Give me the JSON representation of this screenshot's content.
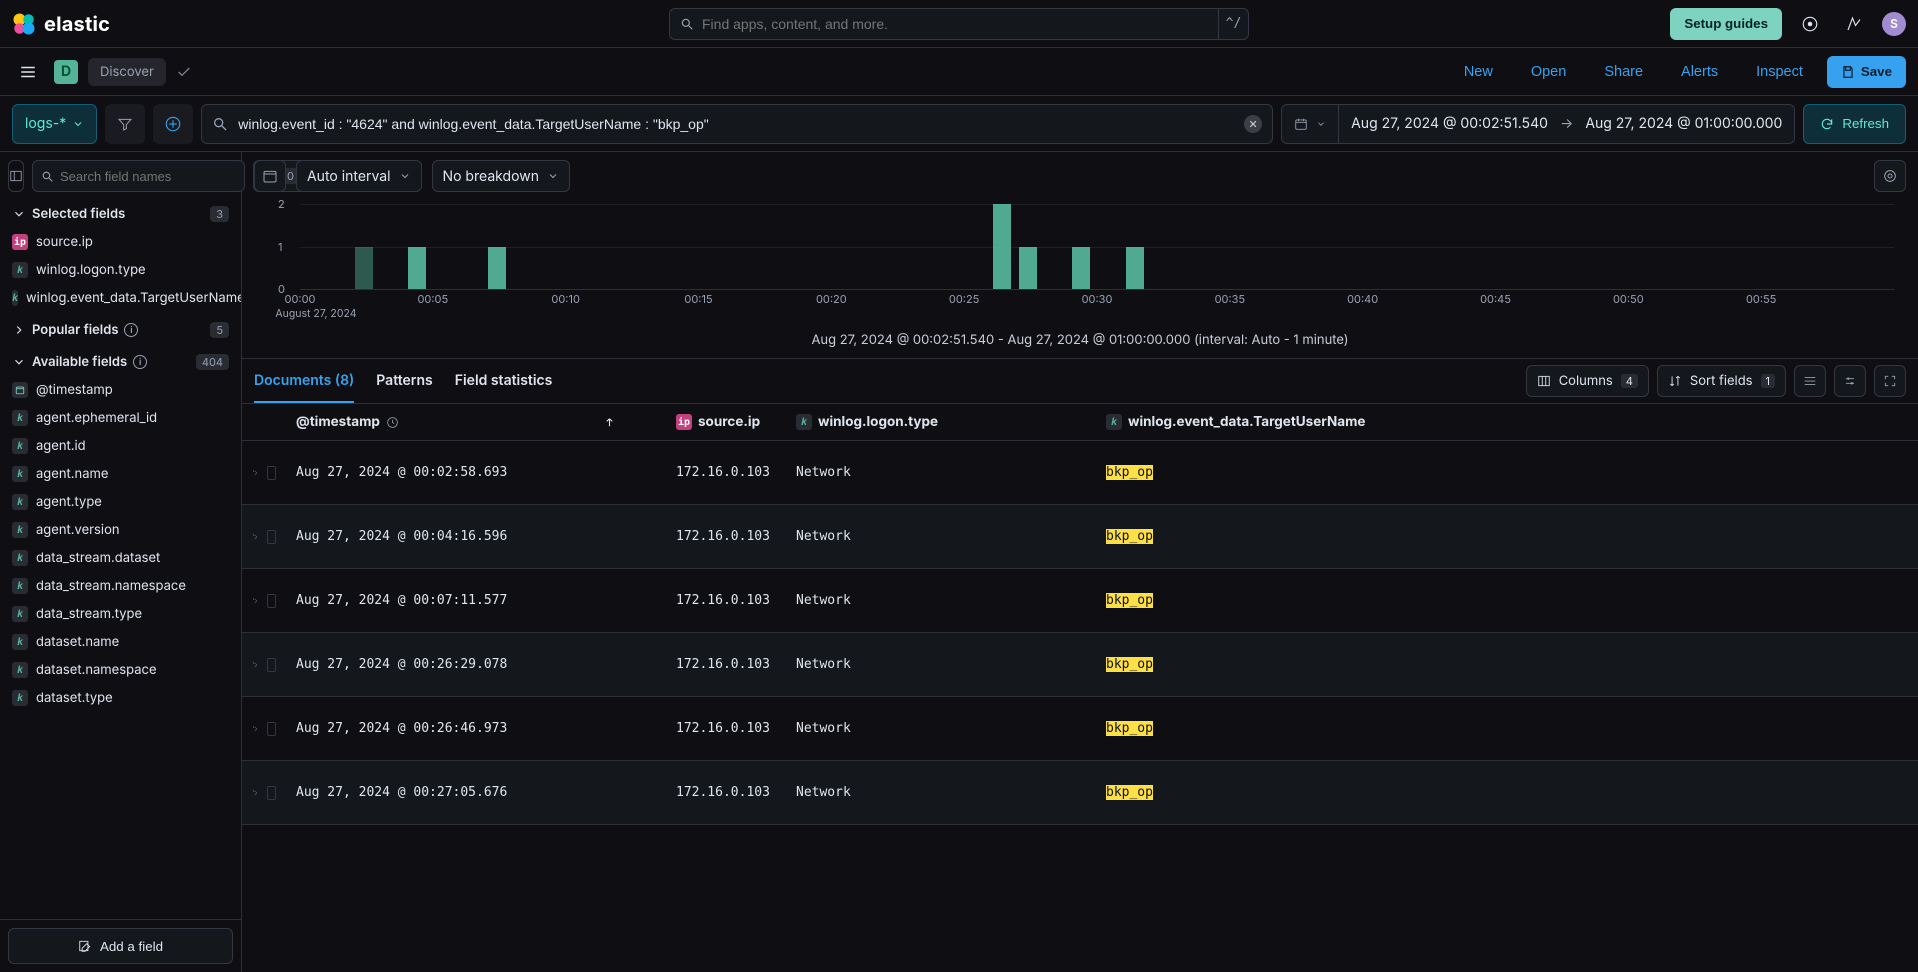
{
  "brand": {
    "text": "elastic",
    "avatar": "S"
  },
  "top": {
    "search_placeholder": "Find apps, content, and more.",
    "shortcut": "^/",
    "setup_guides": "Setup guides"
  },
  "app": {
    "badge": "D",
    "name": "Discover",
    "menu": {
      "new": "New",
      "open": "Open",
      "share": "Share",
      "alerts": "Alerts",
      "inspect": "Inspect",
      "save": "Save"
    }
  },
  "query": {
    "data_view": "logs-*",
    "kql": "winlog.event_id : \"4624\" and winlog.event_data.TargetUserName : \"bkp_op\"",
    "time_start": "Aug 27, 2024 @ 00:02:51.540",
    "time_end": "Aug 27, 2024 @ 01:00:00.000",
    "refresh": "Refresh"
  },
  "sidebar": {
    "search_placeholder": "Search field names",
    "filter_count": "0",
    "sections": {
      "selected": {
        "label": "Selected fields",
        "count": "3"
      },
      "popular": {
        "label": "Popular fields",
        "count": "5"
      },
      "available": {
        "label": "Available fields",
        "count": "404"
      }
    },
    "selected_fields": [
      {
        "icon": "ip",
        "name": "source.ip"
      },
      {
        "icon": "k",
        "name": "winlog.logon.type"
      },
      {
        "icon": "k",
        "name": "winlog.event_data.TargetUserName"
      }
    ],
    "available_fields": [
      {
        "icon": "dt",
        "name": "@timestamp"
      },
      {
        "icon": "k",
        "name": "agent.ephemeral_id"
      },
      {
        "icon": "k",
        "name": "agent.id"
      },
      {
        "icon": "k",
        "name": "agent.name"
      },
      {
        "icon": "k",
        "name": "agent.type"
      },
      {
        "icon": "k",
        "name": "agent.version"
      },
      {
        "icon": "k",
        "name": "data_stream.dataset"
      },
      {
        "icon": "k",
        "name": "data_stream.namespace"
      },
      {
        "icon": "k",
        "name": "data_stream.type"
      },
      {
        "icon": "k",
        "name": "dataset.name"
      },
      {
        "icon": "k",
        "name": "dataset.namespace"
      },
      {
        "icon": "k",
        "name": "dataset.type"
      }
    ],
    "add_field": "Add a field"
  },
  "histo": {
    "interval": "Auto interval",
    "breakdown": "No breakdown",
    "caption": "Aug 27, 2024 @ 00:02:51.540 - Aug 27, 2024 @ 01:00:00.000 (interval: Auto - 1 minute)"
  },
  "chart_data": {
    "type": "bar",
    "title": "",
    "xlabel": "August 27, 2024",
    "ylabel": "",
    "ylim": [
      0,
      2
    ],
    "categories_ticks": [
      "00:00",
      "00:05",
      "00:10",
      "00:15",
      "00:20",
      "00:25",
      "00:30",
      "00:35",
      "00:40",
      "00:45",
      "00:50",
      "00:55"
    ],
    "bars": [
      {
        "minute": 2,
        "value": 1
      },
      {
        "minute": 4,
        "value": 1
      },
      {
        "minute": 7,
        "value": 1
      },
      {
        "minute": 26,
        "value": 2
      },
      {
        "minute": 27,
        "value": 1
      },
      {
        "minute": 29,
        "value": 1
      },
      {
        "minute": 31,
        "value": 1
      }
    ]
  },
  "tabs": {
    "documents": "Documents (8)",
    "patterns": "Patterns",
    "field_stats": "Field statistics"
  },
  "grid_toolbar": {
    "columns": "Columns",
    "columns_n": "4",
    "sort": "Sort fields",
    "sort_n": "1"
  },
  "columns": {
    "ts": "@timestamp",
    "ip": "source.ip",
    "lt": "winlog.logon.type",
    "un": "winlog.event_data.TargetUserName"
  },
  "rows": [
    {
      "ts": "Aug 27, 2024 @ 00:02:58.693",
      "ip": "172.16.0.103",
      "lt": "Network",
      "un": "bkp_op"
    },
    {
      "ts": "Aug 27, 2024 @ 00:04:16.596",
      "ip": "172.16.0.103",
      "lt": "Network",
      "un": "bkp_op"
    },
    {
      "ts": "Aug 27, 2024 @ 00:07:11.577",
      "ip": "172.16.0.103",
      "lt": "Network",
      "un": "bkp_op"
    },
    {
      "ts": "Aug 27, 2024 @ 00:26:29.078",
      "ip": "172.16.0.103",
      "lt": "Network",
      "un": "bkp_op"
    },
    {
      "ts": "Aug 27, 2024 @ 00:26:46.973",
      "ip": "172.16.0.103",
      "lt": "Network",
      "un": "bkp_op"
    },
    {
      "ts": "Aug 27, 2024 @ 00:27:05.676",
      "ip": "172.16.0.103",
      "lt": "Network",
      "un": "bkp_op"
    }
  ]
}
